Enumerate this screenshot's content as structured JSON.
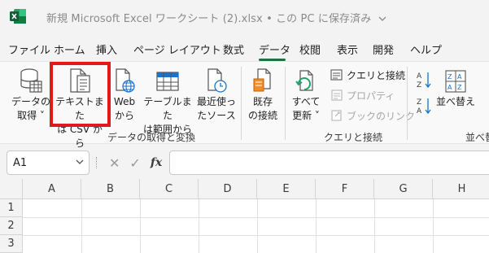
{
  "title": {
    "text": "新規 Microsoft Excel ワークシート (2).xlsx • この PC に保存済み",
    "app_icon": "excel-icon",
    "chevron": "chevron-down-icon"
  },
  "tabs": [
    "ファイル",
    "ホーム",
    "挿入",
    "ページ レイアウト",
    "数式",
    "データ",
    "校閲",
    "表示",
    "開発",
    "ヘルプ"
  ],
  "active_tab": "データ",
  "ribbon": {
    "get_data": "データの\n取得 ˅",
    "from_text_csv": "テキストまた\nは CSV から",
    "from_web": "Web\nから",
    "from_table": "テーブルまた\nは範囲から",
    "recent_sources": "最近使っ\nたソース",
    "existing_connections": "既存\nの接続",
    "refresh_all": "すべて\n更新 ˅",
    "queries_connections": "クエリと接続",
    "properties": "プロパティ",
    "edit_links": "ブックのリンク",
    "sort_label": "並べ替え",
    "group_get_transform": "データの取得と変換",
    "group_queries": "クエリと接続",
    "group_sort_partial": "並べ替"
  },
  "formula_bar": {
    "name_box": "A1",
    "cancel": "✕",
    "enter": "✓",
    "fx": "fx",
    "value": ""
  },
  "grid": {
    "columns": [
      "A",
      "B",
      "C",
      "D",
      "E",
      "F",
      "G",
      "H"
    ],
    "rows": [
      "1",
      "2",
      "3"
    ]
  },
  "colors": {
    "accent": "#1e7145",
    "highlight": "#e0191c"
  }
}
